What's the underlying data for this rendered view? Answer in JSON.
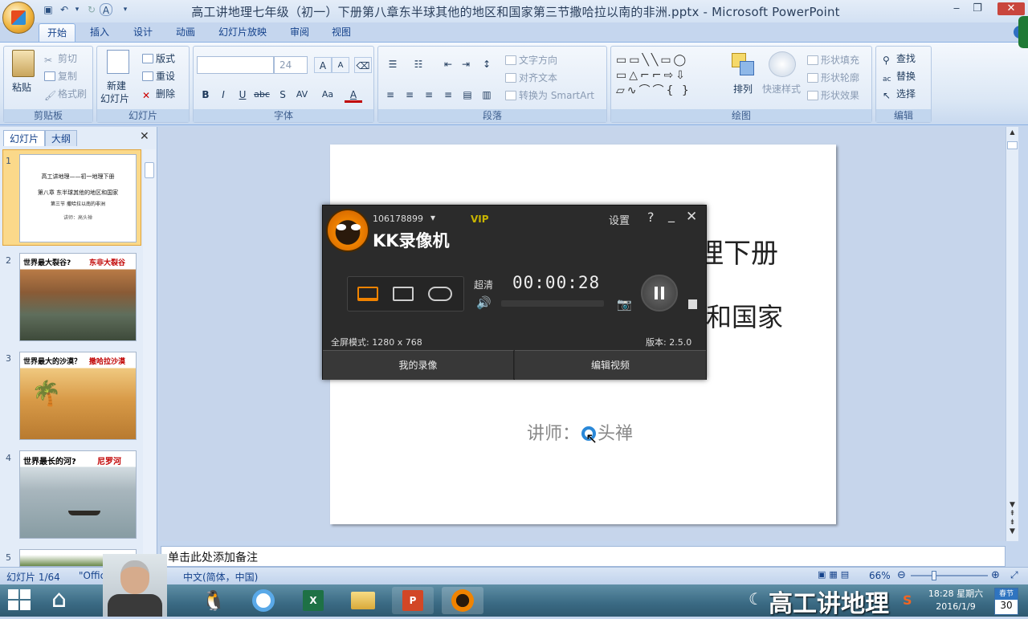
{
  "window": {
    "title": "高工讲地理七年级（初一）下册第八章东半球其他的地区和国家第三节撒哈拉以南的非洲.pptx - Microsoft PowerPoint",
    "qat": [
      "save-icon",
      "undo-icon",
      "redo-icon",
      "A",
      "dropdown-icon"
    ]
  },
  "tabs": [
    "开始",
    "插入",
    "设计",
    "动画",
    "幻灯片放映",
    "审阅",
    "视图"
  ],
  "ribbon": {
    "clipboard": {
      "label": "剪贴板",
      "paste": "粘贴",
      "cut": "剪切",
      "copy": "复制",
      "format_painter": "格式刷"
    },
    "slides": {
      "label": "幻灯片",
      "new_slide": "新建",
      "new_slide2": "幻灯片",
      "layout": "版式",
      "reset": "重设",
      "delete": "删除"
    },
    "font": {
      "label": "字体",
      "size": "24",
      "bold": "B",
      "italic": "I",
      "underline": "U",
      "strike": "abc",
      "shadow": "S",
      "spacing": "AV",
      "case": "Aa",
      "color": "A",
      "grow": "A",
      "shrink": "A"
    },
    "paragraph": {
      "label": "段落",
      "text_direction": "文字方向",
      "align_text": "对齐文本",
      "smartart": "转换为 SmartArt"
    },
    "drawing": {
      "label": "绘图",
      "arrange": "排列",
      "quick_styles": "快速样式",
      "fill": "形状填充",
      "outline": "形状轮廓",
      "effects": "形状效果"
    },
    "editing": {
      "label": "编辑",
      "find": "查找",
      "replace": "替换",
      "select": "选择"
    }
  },
  "panel": {
    "tab_slides": "幻灯片",
    "tab_outline": "大纲"
  },
  "thumbnails": [
    {
      "num": "1",
      "lines": [
        "高工讲地理——初一地理下册",
        "第八章 东半球其他的地区和国家",
        "第三节 撒哈拉以南的非洲",
        "讲师：高头禅"
      ]
    },
    {
      "num": "2",
      "title": "世界最大裂谷?",
      "tag": "东非大裂谷"
    },
    {
      "num": "3",
      "title": "世界最大的沙漠？",
      "tag": "撒哈拉沙漠"
    },
    {
      "num": "4",
      "title": "世界最长的河?",
      "tag": "尼罗河"
    },
    {
      "num": "5"
    }
  ],
  "slide": {
    "line1": "理下册",
    "line2": "和国家",
    "lecturer_prefix": "讲师：",
    "lecturer_name": "头禅"
  },
  "kk": {
    "id": "106178899",
    "vip": "VIP",
    "brand": "KK录像机",
    "settings": "设置",
    "help": "?",
    "quality": "超清",
    "timer": "00:00:28",
    "mode": "全屏模式: 1280 x 768",
    "version": "版本: 2.5.0",
    "my_recordings": "我的录像",
    "edit_video": "编辑视频"
  },
  "notes": {
    "placeholder": "单击此处添加备注"
  },
  "status": {
    "slide": "幻灯片 1/64",
    "theme": "\"Office 主题\"",
    "theme_short": "\"Offic",
    "lang": "中文(简体，中国)",
    "zoom": "66%"
  },
  "taskbar": {
    "time": "18:28 星期六",
    "date": "2016/1/9",
    "cal_top": "春节",
    "cal_num": "30",
    "watermark": "高工讲地理"
  },
  "colors": {
    "accent": "#c00000",
    "kk_orange": "#f08300",
    "vip": "#c8b400"
  }
}
